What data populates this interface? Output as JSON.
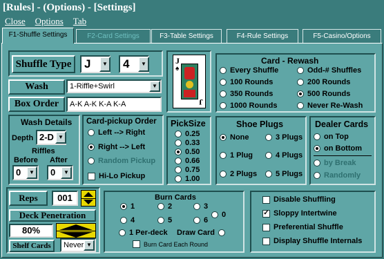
{
  "title": "[Rules] - (Options) - [Settings]",
  "menu": [
    "Close",
    "Options",
    "Tab"
  ],
  "tabs": [
    "F1-Shuffle Settings",
    "F2-Card Settings",
    "F3-Table Settings",
    "F4-Rule Settings",
    "F5-Casino/Options"
  ],
  "shuffle": {
    "label": "Shuffle Type",
    "type": "J",
    "count": "4"
  },
  "wash": {
    "label": "Wash",
    "value": "1-Riffle+Swirl"
  },
  "box_order": {
    "label": "Box Order",
    "value": "A-K A-K K-A K-A"
  },
  "wash_details": {
    "title": "Wash Details",
    "depth_label": "Depth",
    "depth": "2-D",
    "riffles": "Riffles",
    "before_label": "Before",
    "before": "0",
    "after_label": "After",
    "after": "0"
  },
  "pickup": {
    "title": "Card-pickup Order",
    "opts": [
      "Left --> Right",
      "Right --> Left",
      "Random Pickup"
    ],
    "hilo": "Hi-Lo Pickup"
  },
  "rewash": {
    "title": "Card - Rewash",
    "opts": [
      "Every Shuffle",
      "Odd-# Shuffles",
      "100 Rounds",
      "200 Rounds",
      "350 Rounds",
      "500 Rounds",
      "1000 Rounds",
      "Never Re-Wash"
    ]
  },
  "picksize": {
    "title": "PickSize",
    "opts": [
      "0.25",
      "0.33",
      "0.50",
      "0.66",
      "0.75",
      "1.00"
    ]
  },
  "shoe": {
    "title": "Shoe Plugs",
    "opts": [
      "None",
      "3 Plugs",
      "1 Plug",
      "4 Plugs",
      "2 Plugs",
      "5 Plugs"
    ]
  },
  "dealer": {
    "title": "Dealer Cards",
    "opts": [
      "on Top",
      "on Bottom",
      "by Break",
      "Randomly"
    ]
  },
  "reps": {
    "label": "Reps",
    "value": "001"
  },
  "deck_pen": {
    "label": "Deck Penetration",
    "value": "80%"
  },
  "shelf": {
    "label": "Shelf Cards",
    "value": "Never"
  },
  "burn": {
    "title": "Burn Cards",
    "nums": [
      "1",
      "2",
      "3",
      "0",
      "4",
      "5",
      "6"
    ],
    "per_deck": "1 Per-deck",
    "draw": "Draw Card",
    "each_round": "Burn Card Each Round"
  },
  "options": [
    "Disable Shuffling",
    "Sloppy Intertwine",
    "Preferential Shuffle",
    "Display Shuffle Internals"
  ],
  "card": {
    "rank": "J",
    "suit": "♠"
  }
}
